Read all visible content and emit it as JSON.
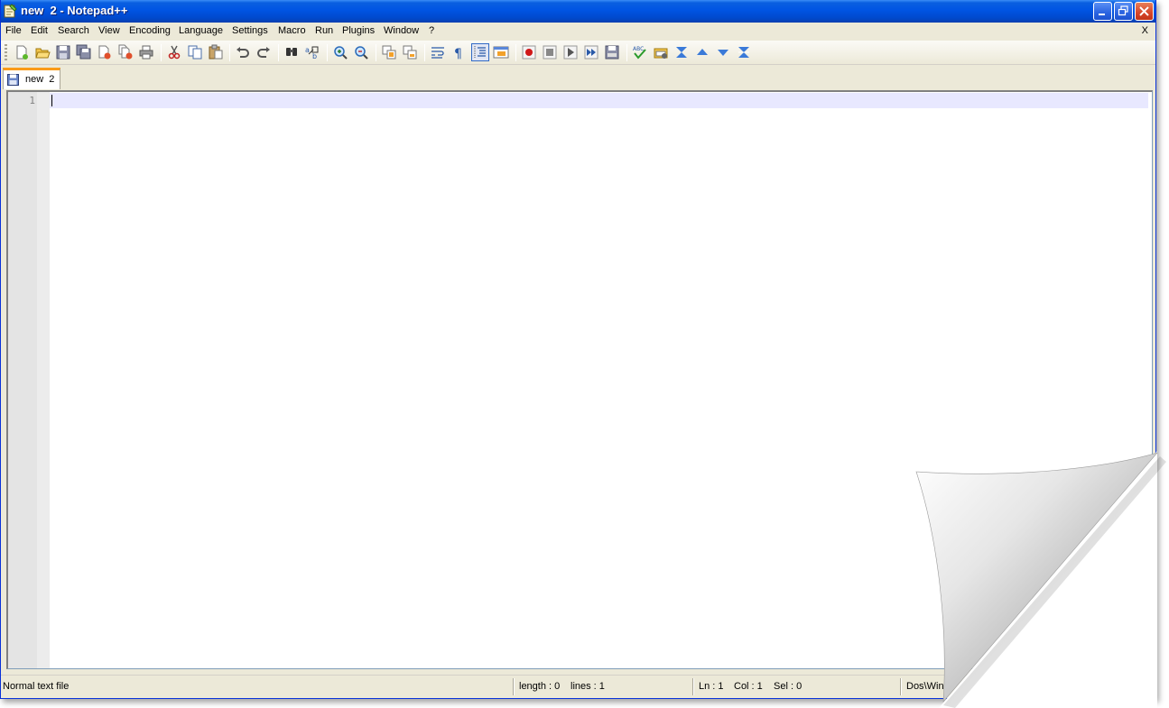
{
  "window": {
    "title": "new  2 - Notepad++"
  },
  "menu": {
    "items": [
      "File",
      "Edit",
      "Search",
      "View",
      "Encoding",
      "Language",
      "Settings",
      "Macro",
      "Run",
      "Plugins",
      "Window",
      "?"
    ],
    "close_label": "X"
  },
  "toolbar": {
    "buttons": [
      "new-file",
      "open-file",
      "save",
      "save-all",
      "close",
      "close-all",
      "print",
      "cut",
      "copy",
      "paste",
      "undo",
      "redo",
      "find",
      "replace",
      "zoom-in",
      "zoom-out",
      "sync-vertical",
      "sync-horizontal",
      "word-wrap",
      "show-all-characters",
      "indent-guide",
      "user-defined-dialog",
      "record-macro",
      "stop-recording",
      "play-macro",
      "run-macro-multiple",
      "save-macro",
      "spell-check",
      "spell-options",
      "compare",
      "previous-difference",
      "next-difference",
      "last-difference"
    ],
    "active": [
      "indent-guide"
    ]
  },
  "tabs": [
    {
      "label": "new  2",
      "active": true
    }
  ],
  "editor": {
    "line_numbers": [
      "1"
    ],
    "content": ""
  },
  "status": {
    "file_type": "Normal text file",
    "length": "length : 0",
    "lines": "lines : 1",
    "ln": "Ln : 1",
    "col": "Col : 1",
    "sel": "Sel : 0",
    "eol": "Dos\\Win"
  },
  "colors": {
    "titlebar": "#0054e3",
    "chrome": "#ece9d8",
    "tab_accent": "#fa9b18",
    "caret_line": "#e8e8ff",
    "gutter": "#e4e4e4"
  }
}
